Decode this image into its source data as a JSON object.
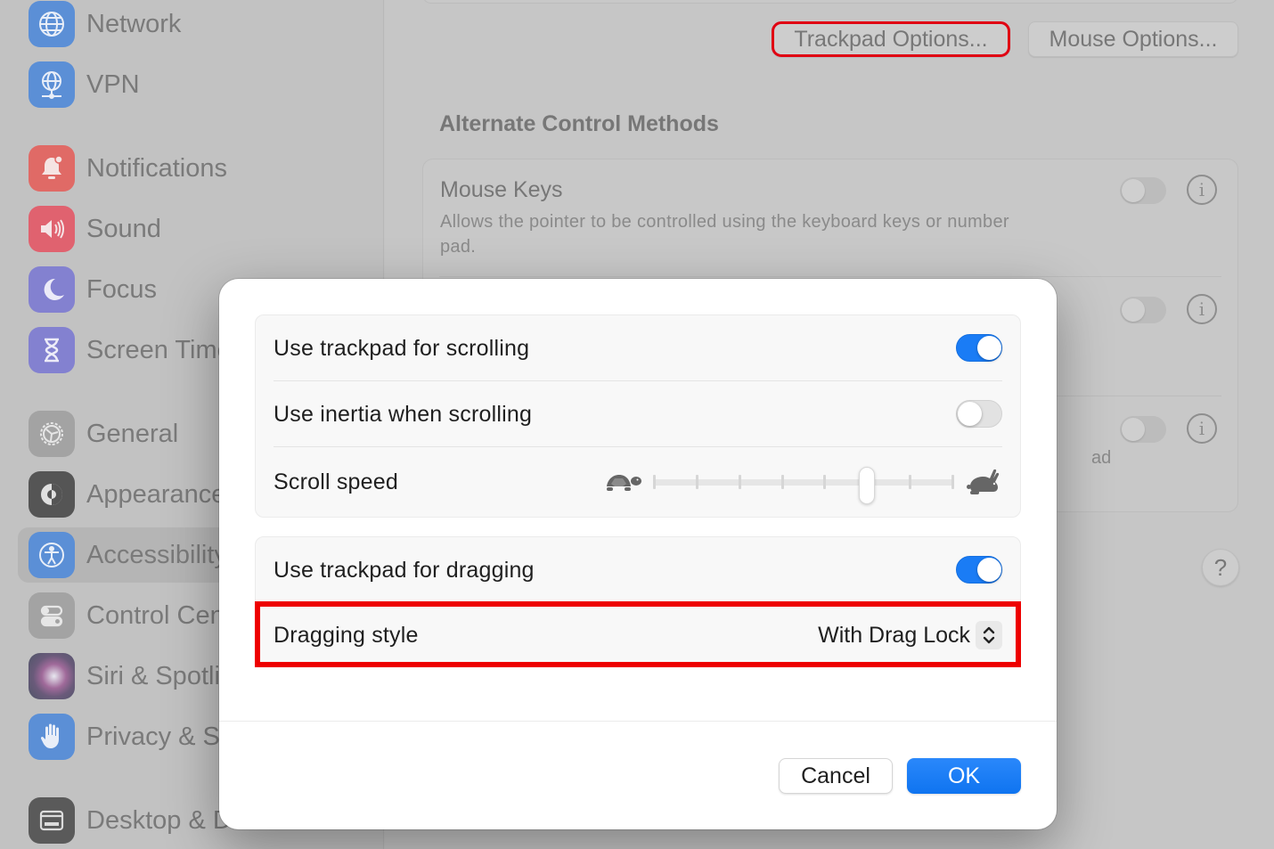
{
  "sidebar": {
    "items": [
      {
        "label": "Network",
        "icon": "globe-icon",
        "color": "#5b8fd6"
      },
      {
        "label": "VPN",
        "icon": "vpn-globe-icon",
        "color": "#5b8fd6"
      },
      {
        "label": "Notifications",
        "icon": "bell-icon",
        "color": "#e06a66"
      },
      {
        "label": "Sound",
        "icon": "speaker-icon",
        "color": "#e0626f"
      },
      {
        "label": "Focus",
        "icon": "moon-icon",
        "color": "#8381d0"
      },
      {
        "label": "Screen Time",
        "icon": "hourglass-icon",
        "color": "#8381d0"
      },
      {
        "label": "General",
        "icon": "gear-icon",
        "color": "#a3a3a3"
      },
      {
        "label": "Appearance",
        "icon": "appearance-icon",
        "color": "#555555"
      },
      {
        "label": "Accessibility",
        "icon": "accessibility-icon",
        "color": "#5b8fd6",
        "selected": true
      },
      {
        "label": "Control Centre",
        "icon": "control-centre-icon",
        "color": "#a3a3a3"
      },
      {
        "label": "Siri & Spotlight",
        "icon": "siri-icon",
        "color": "#6a5a7a"
      },
      {
        "label": "Privacy & Security",
        "icon": "hand-icon",
        "color": "#5b8fd6"
      },
      {
        "label": "Desktop & Dock",
        "icon": "desktop-icon",
        "color": "#5a5a5a"
      }
    ]
  },
  "main": {
    "trackpad_options_label": "Trackpad Options...",
    "mouse_options_label": "Mouse Options...",
    "section_title": "Alternate Control Methods",
    "alternate_rows": [
      {
        "title": "Mouse Keys",
        "description": "Allows the pointer to be controlled using the keyboard keys or number pad.",
        "enabled": false
      },
      {
        "title": "",
        "description": "",
        "enabled": false
      },
      {
        "title": "",
        "description": "",
        "enabled": false,
        "partial_text": "ad"
      }
    ],
    "help_label": "?"
  },
  "dialog": {
    "scrolling_group": {
      "use_trackpad_scrolling": {
        "label": "Use trackpad for scrolling",
        "enabled": true
      },
      "use_inertia": {
        "label": "Use inertia when scrolling",
        "enabled": false
      },
      "scroll_speed": {
        "label": "Scroll speed",
        "min_icon": "turtle-icon",
        "max_icon": "rabbit-icon",
        "ticks": 8,
        "value_fraction": 0.71
      }
    },
    "dragging_group": {
      "use_trackpad_dragging": {
        "label": "Use trackpad for dragging",
        "enabled": true
      },
      "dragging_style": {
        "label": "Dragging style",
        "value": "With Drag Lock"
      }
    },
    "cancel_label": "Cancel",
    "ok_label": "OK"
  },
  "colors": {
    "accent": "#1a7cf5",
    "highlight": "#ee0000"
  }
}
